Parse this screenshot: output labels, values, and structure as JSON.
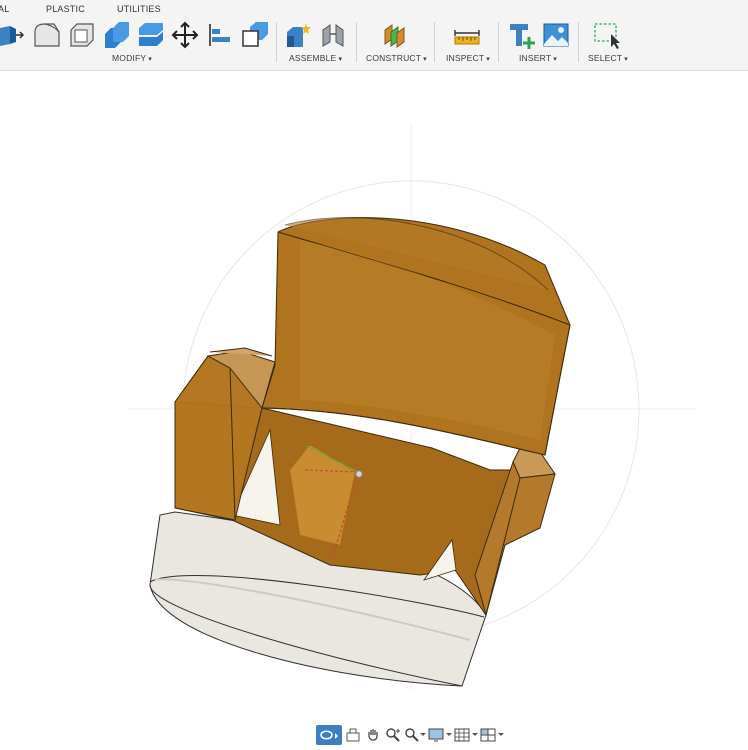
{
  "tabs": [
    {
      "label": "AL"
    },
    {
      "label": "PLASTIC"
    },
    {
      "label": "UTILITIES"
    }
  ],
  "groups": {
    "modify": "MODIFY",
    "assemble": "ASSEMBLE",
    "construct": "CONSTRUCT",
    "inspect": "INSPECT",
    "insert": "INSERT",
    "select": "SELECT"
  },
  "caret": "▾",
  "icons": {
    "modify": [
      "press-pull-icon",
      "fillet-icon",
      "shell-icon",
      "combine-icon",
      "split-face-icon",
      "move-icon",
      "align-icon",
      "scale-icon"
    ],
    "assemble": [
      "new-component-icon",
      "joint-icon"
    ],
    "construct": [
      "offset-plane-icon"
    ],
    "inspect": [
      "measure-icon"
    ],
    "insert": [
      "insert-mesh-icon",
      "canvas-icon"
    ],
    "select": [
      "select-box-icon"
    ]
  },
  "navbar": [
    "orbit-icon",
    "look-at-icon",
    "pan-icon",
    "zoom-icon",
    "fit-icon",
    "display-settings-icon",
    "grid-icon",
    "viewports-icon"
  ],
  "colors": {
    "body_orange": "#a9701d",
    "base_white": "#e9e7df",
    "accent_blue": "#3d7fc4"
  }
}
